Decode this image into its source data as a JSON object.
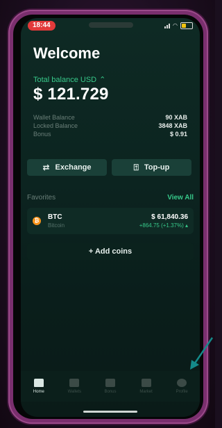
{
  "status_bar": {
    "time": "18:44"
  },
  "header": {
    "welcome": "Welcome"
  },
  "balance": {
    "label": "Total balance USD",
    "label_icon": "chevron-up-icon",
    "value": "$ 121.729"
  },
  "breakdown": [
    {
      "label": "Wallet Balance",
      "value": "90 XAB"
    },
    {
      "label": "Locked Balance",
      "value": "3848 XAB"
    },
    {
      "label": "Bonus",
      "value": "$ 0.91"
    }
  ],
  "actions": {
    "exchange_label": "Exchange",
    "topup_label": "Top-up"
  },
  "favorites": {
    "label": "Favorites",
    "view_all_label": "View All",
    "coins": [
      {
        "symbol": "BTC",
        "name": "Bitcoin",
        "price": "$ 61,840.36",
        "change": "+864.75 (+1.37%) ▴"
      }
    ],
    "add_coins_label": "+ Add coins"
  },
  "tabbar": {
    "items": [
      {
        "label": "Home",
        "icon": "home-icon"
      },
      {
        "label": "Wallets",
        "icon": "wallet-icon"
      },
      {
        "label": "Bonus",
        "icon": "bonus-icon"
      },
      {
        "label": "Market",
        "icon": "chart-icon"
      },
      {
        "label": "Profile",
        "icon": "profile-icon"
      }
    ]
  },
  "colors": {
    "accent_green": "#37c98a",
    "time_pill_red": "#e23a3a",
    "screen_bg": "#0c2420",
    "button_bg": "#1a4038",
    "frame_purple": "#7a2f6e",
    "arrow_teal": "#148a8a"
  }
}
